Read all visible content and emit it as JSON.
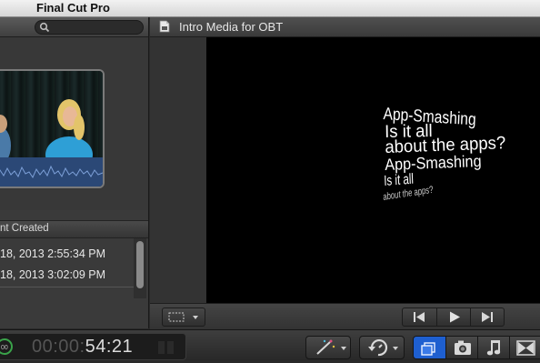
{
  "app": {
    "name": "Final Cut Pro"
  },
  "browser": {
    "column_header": "nt Created",
    "rows": [
      {
        "date": "18, 2013 2:55:34 PM"
      },
      {
        "date": "18, 2013 3:02:09 PM"
      }
    ]
  },
  "viewer": {
    "title": "Intro Media for OBT",
    "overlay_lines": [
      "App-Smashing",
      "Is it all",
      "about the apps?",
      "App-Smashing",
      "Is it all",
      "about the apps?"
    ]
  },
  "timecode": {
    "dim": "00:00:",
    "main": "54:21"
  },
  "icons": {
    "search": "search-icon",
    "document": "document-icon",
    "view_options": "view-options-icon",
    "previous": "previous-frame-icon",
    "play": "play-icon",
    "next": "next-frame-icon",
    "magic_wand": "magic-wand-icon",
    "retime": "retime-icon",
    "photo_browser": "camera-icon",
    "music_browser": "music-note-icon",
    "transitions": "transitions-icon",
    "browser": "browser-icon"
  },
  "colors": {
    "accent_blue": "#2f6fd6",
    "waveform": "#2b4876"
  }
}
